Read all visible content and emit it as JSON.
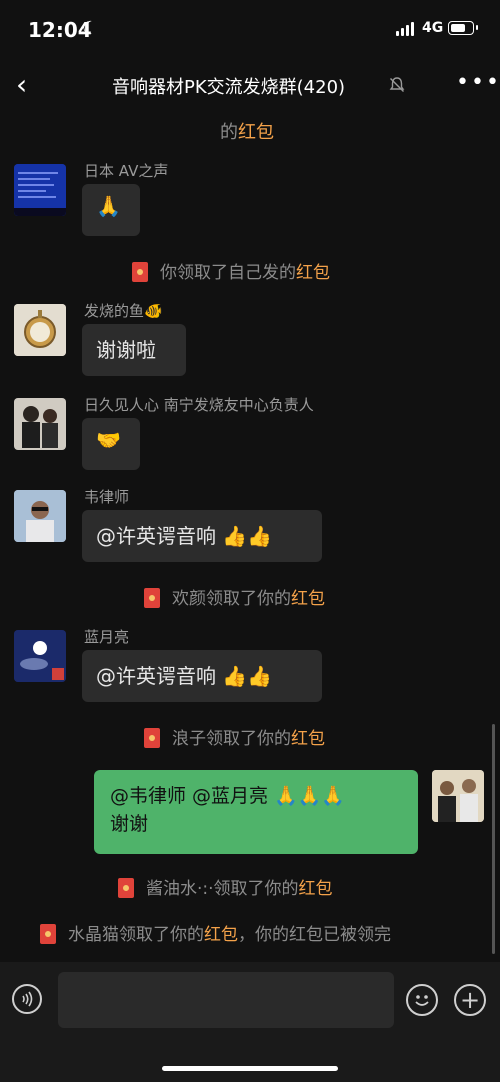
{
  "status": {
    "time": "12:04",
    "network": "4G"
  },
  "header": {
    "title": "音响器材PK交流发烧群(420)"
  },
  "messages": {
    "top_partial": {
      "prefix": "的",
      "highlight": "红包"
    },
    "m1": {
      "name": "日本 AV之声",
      "text": "🙏"
    },
    "sys1": {
      "text": "你领取了自己发的",
      "highlight": "红包"
    },
    "m2": {
      "name": "发烧的鱼🐠",
      "text": "谢谢啦"
    },
    "m3": {
      "name": "日久见人心 南宁发烧友中心负责人",
      "text": "🤝"
    },
    "m4": {
      "name": "韦律师",
      "text": "@许英谔音响 👍👍"
    },
    "sys2": {
      "text": "欢颜领取了你的",
      "highlight": "红包"
    },
    "m5": {
      "name": "蓝月亮",
      "text": "@许英谔音响 👍👍"
    },
    "sys3": {
      "text": "浪子领取了你的",
      "highlight": "红包"
    },
    "mine": {
      "line1": "@韦律师 @蓝月亮 🙏🙏🙏",
      "line2": "谢谢"
    },
    "sys4": {
      "text": "酱油水·:·领取了你的",
      "highlight": "红包"
    },
    "sys5": {
      "text": "水晶猫领取了你的",
      "highlight": "红包",
      "suffix": "，你的红包已被领完"
    }
  }
}
